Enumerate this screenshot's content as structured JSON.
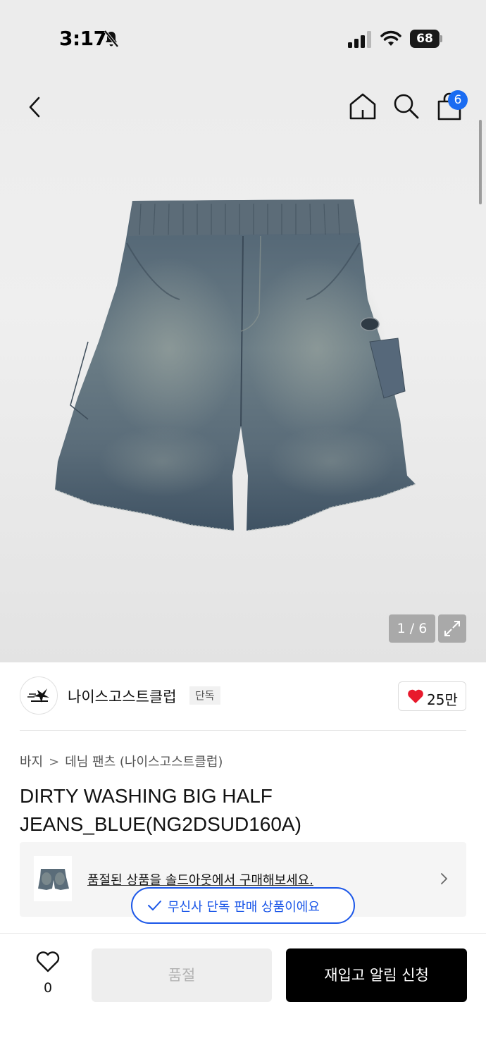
{
  "status_bar": {
    "time": "3:17",
    "battery": "68"
  },
  "header": {
    "cart_count": "6"
  },
  "gallery": {
    "counter": "1 / 6"
  },
  "brand": {
    "name": "나이스고스트클럽",
    "badge": "단독",
    "likes": "25만"
  },
  "breadcrumb": {
    "category": "바지",
    "subcategory": "데님 팬츠 (나이스고스트클럽)"
  },
  "product": {
    "title": "DIRTY WASHING BIG HALF JEANS_BLUE(NG2DSUD160A)"
  },
  "resale": {
    "text": "품절된 상품을 솔드아웃에서 구매해보세요."
  },
  "exclusive_notice": {
    "text": "무신사 단독 판매 상품이에요"
  },
  "bottom": {
    "wish_count": "0",
    "soldout_label": "품절",
    "restock_label": "재입고 알림 신청"
  },
  "colors": {
    "accent_blue": "#1a56e8",
    "badge_blue": "#1a6cf2",
    "heart_red": "#e8192c"
  }
}
